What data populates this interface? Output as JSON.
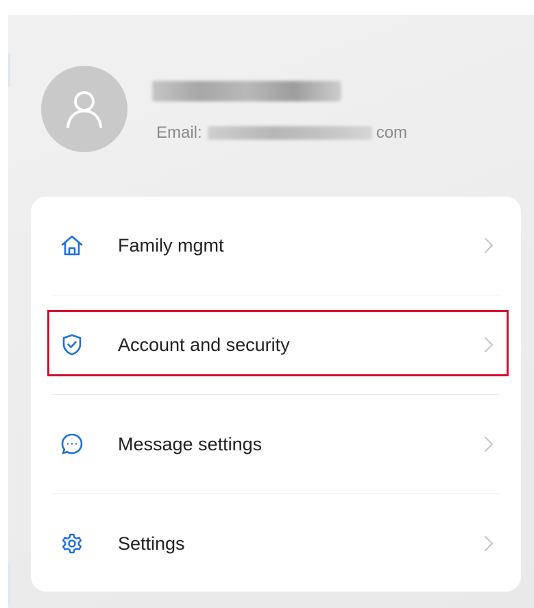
{
  "profile": {
    "avatar_icon": "user-outline-icon",
    "name": "",
    "email_prefix": "Email:",
    "email_suffix": "com"
  },
  "menu": {
    "items": [
      {
        "label": "Family mgmt",
        "icon": "home-icon"
      },
      {
        "label": "Account and security",
        "icon": "shield-check-icon"
      },
      {
        "label": "Message settings",
        "icon": "chat-bubble-icon"
      },
      {
        "label": "Settings",
        "icon": "gear-icon"
      }
    ],
    "chevron_icon": "chevron-right-icon",
    "highlighted_item": "Account and security"
  },
  "colors": {
    "accent": "#1d6fe0",
    "highlight_border": "#d20f2a",
    "avatar_bg": "#c9c9c9",
    "screen_bg": "#eeeeee",
    "card_bg": "#ffffff",
    "label_text": "#222222",
    "email_text": "#8a8a8a",
    "chevron": "#c4c4c4"
  }
}
